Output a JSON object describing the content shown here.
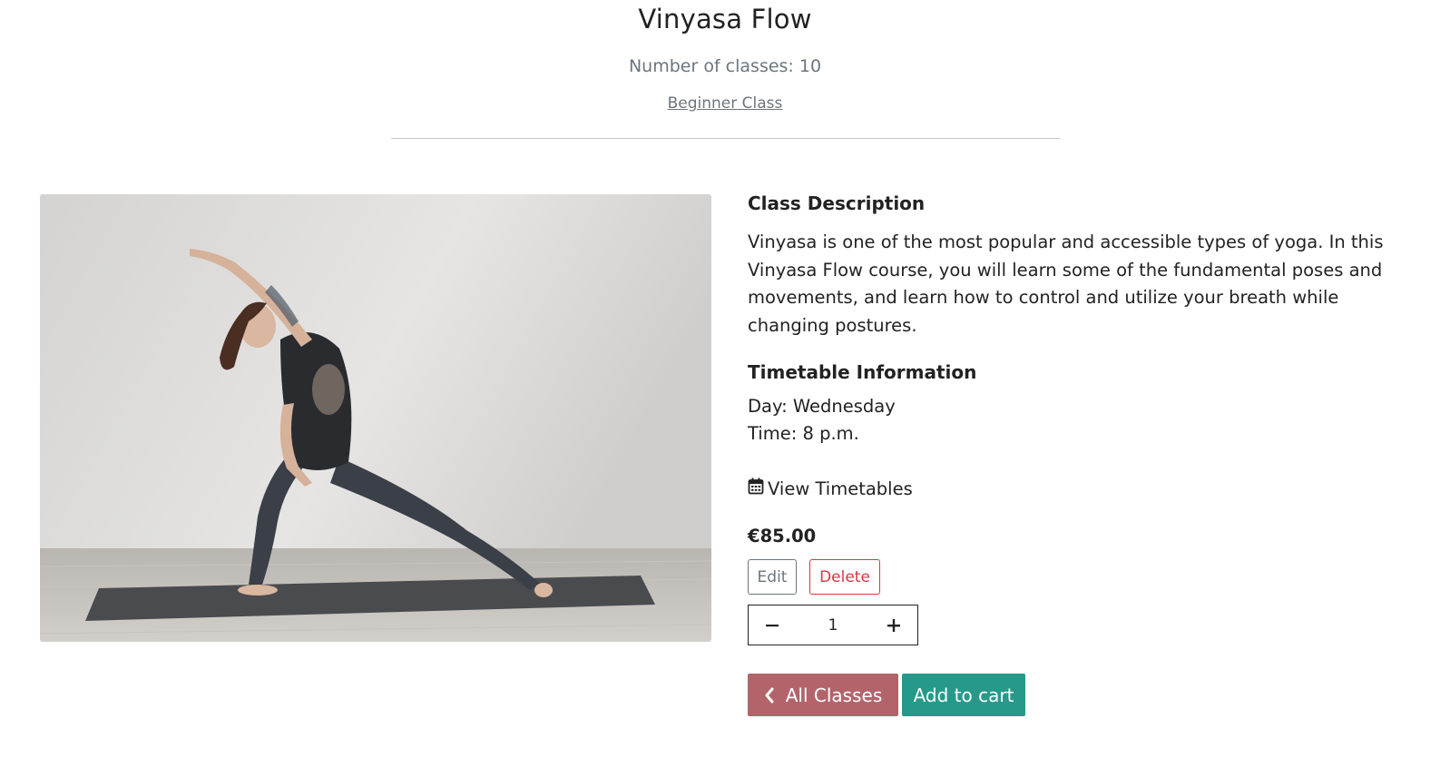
{
  "course": {
    "title": "Vinyasa Flow",
    "num_classes": "Number of classes: 10",
    "level": "Beginner Class",
    "image_alt": "woman in extended side angle yoga pose on mat"
  },
  "description": {
    "heading": "Class Description",
    "text": "Vinyasa is one of the most popular and accessible types of yoga. In this Vinyasa Flow course, you will learn some of the fundamental poses and movements, and learn how to control and utilize your breath while changing postures."
  },
  "timetable": {
    "heading": "Timetable Information",
    "day": "Day: Wednesday",
    "time": "Time: 8 p.m.",
    "view_link": "View Timetables",
    "icon": "calendar-icon"
  },
  "price": "€85.00",
  "admin": {
    "edit_label": "Edit",
    "delete_label": "Delete"
  },
  "quantity": {
    "value": "1",
    "minus_icon": "minus-icon",
    "plus_icon": "plus-icon"
  },
  "actions": {
    "all_classes_label": "All Classes",
    "all_classes_icon": "chevron-left-icon",
    "add_to_cart_label": "Add to cart"
  },
  "colors": {
    "all_classes_bg": "#b3646b",
    "add_to_cart_bg": "#27998a",
    "delete_color": "#dc3545",
    "muted_text": "#6c757d"
  }
}
